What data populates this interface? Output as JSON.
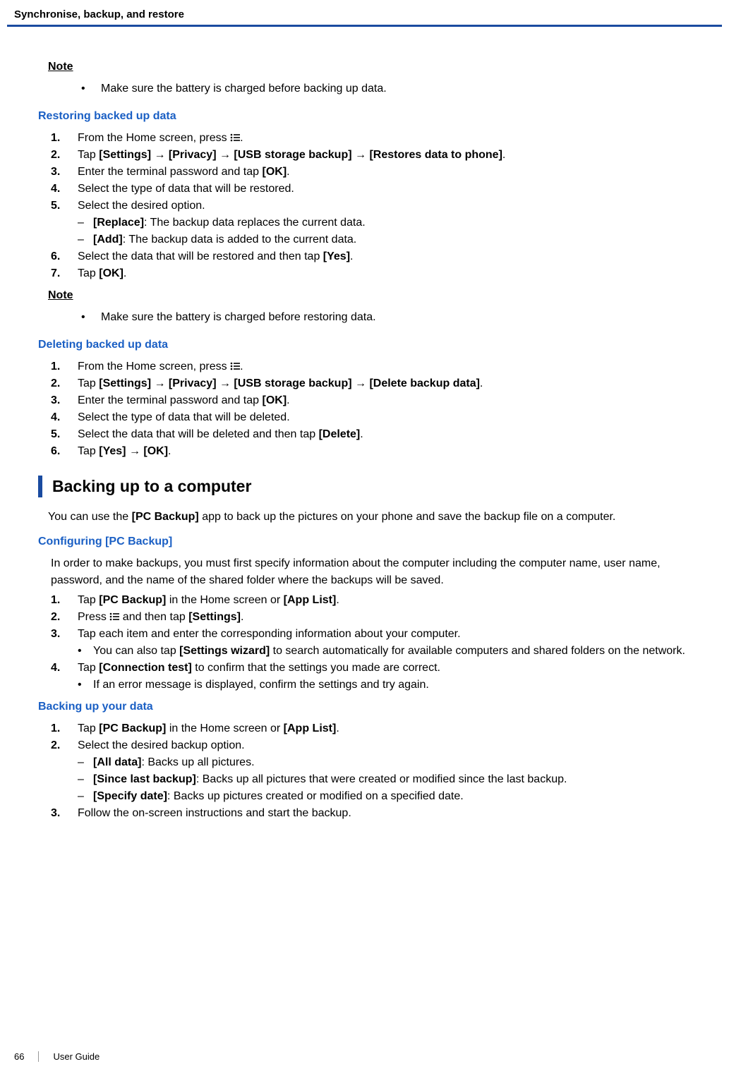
{
  "header": {
    "chapter_title": "Synchronise, backup, and restore"
  },
  "note1": {
    "label": "Note",
    "item": "Make sure the battery is charged before backing up data."
  },
  "restoring": {
    "heading": "Restoring backed up data",
    "steps": {
      "s1_pre": "From the Home screen, press ",
      "s1_post": ".",
      "s2": "Tap [Settings] → [Privacy] → [USB storage backup] → [Restores data to phone].",
      "s3": "Enter the terminal password and tap [OK].",
      "s4": "Select the type of data that will be restored.",
      "s5": "Select the desired option.",
      "s5a": "[Replace]: The backup data replaces the current data.",
      "s5b": "[Add]: The backup data is added to the current data.",
      "s6": "Select the data that will be restored and then tap [Yes].",
      "s7": "Tap [OK]."
    }
  },
  "note2": {
    "label": "Note",
    "item": "Make sure the battery is charged before restoring data."
  },
  "deleting": {
    "heading": "Deleting backed up data",
    "steps": {
      "s1_pre": "From the Home screen, press ",
      "s1_post": ".",
      "s2": "Tap [Settings] → [Privacy] → [USB storage backup] → [Delete backup data].",
      "s3": "Enter the terminal password and tap [OK].",
      "s4": "Select the type of data that will be deleted.",
      "s5": "Select the data that will be deleted and then tap [Delete].",
      "s6": "Tap [Yes] → [OK]."
    }
  },
  "backing_up_computer": {
    "heading": "Backing up to a computer",
    "intro": "You can use the [PC Backup] app to back up the pictures on your phone and save the backup file on a computer."
  },
  "configuring": {
    "heading": "Configuring [PC Backup]",
    "intro": "In order to make backups, you must first specify information about the computer including the computer name, user name, password, and the name of the shared folder where the backups will be saved.",
    "steps": {
      "s1": "Tap [PC Backup] in the Home screen or [App List].",
      "s2_pre": "Press ",
      "s2_post": " and then tap [Settings].",
      "s3": "Tap each item and enter the corresponding information about your computer.",
      "s3a": "You can also tap [Settings wizard] to search automatically for available computers and shared folders on the network.",
      "s4": "Tap [Connection test] to confirm that the settings you made are correct.",
      "s4a": "If an error message is displayed, confirm the settings and try again."
    }
  },
  "backing_data": {
    "heading": "Backing up your data",
    "steps": {
      "s1": "Tap [PC Backup] in the Home screen or [App List].",
      "s2": "Select the desired backup option.",
      "s2a": "[All data]: Backs up all pictures.",
      "s2b": "[Since last backup]: Backs up all pictures that were created or modified since the last backup.",
      "s2c": "[Specify date]: Backs up pictures created or modified on a specified date.",
      "s3": "Follow the on-screen instructions and start the backup."
    }
  },
  "footer": {
    "page_num": "66",
    "doc_title": "User Guide"
  }
}
